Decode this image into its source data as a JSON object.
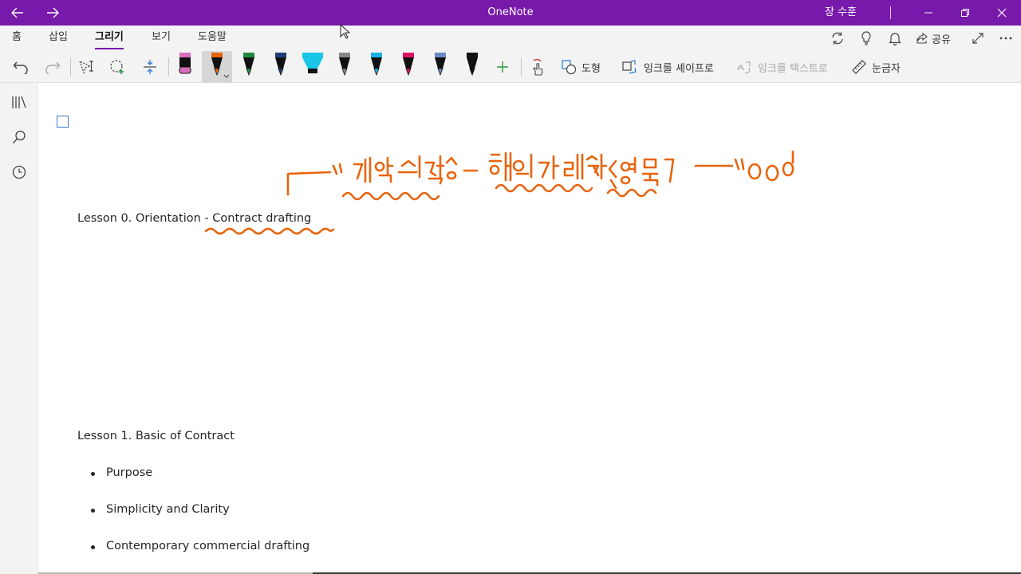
{
  "titlebar": {
    "app_title": "OneNote",
    "user_name": "장 수훈",
    "back_icon": "arrow-left-icon",
    "forward_icon": "arrow-right-icon",
    "color": "#7719aa"
  },
  "menu": {
    "tabs": [
      {
        "label": "홈"
      },
      {
        "label": "삽입"
      },
      {
        "label": "그리기"
      },
      {
        "label": "보기"
      },
      {
        "label": "도움말"
      }
    ],
    "active_tab": "그리기",
    "share_label": "공유"
  },
  "toolbar": {
    "shape_label": "도형",
    "ink_to_shape_label": "잉크를 셰이프로",
    "ink_to_text_label": "잉크를 텍스트로",
    "ruler_label": "눈금자",
    "pen_colors": [
      "#d86ec0",
      "#e8640c",
      "#1f8a3c",
      "#1f3f7a",
      "#19c6e6",
      "#888888",
      "#19b4e6",
      "#e0136b",
      "#6a8ac8",
      "#111111"
    ],
    "selected_pen_color": "#e8640c"
  },
  "page": {
    "lesson0_prefix": "Lesson 0. Orientation ",
    "lesson0_suffix": "- Contract drafting",
    "lesson1_title": "Lesson 1. Basic of Contract",
    "bullets": [
      "Purpose",
      "Simplicity and Clarity",
      "Contemporary commercial drafting"
    ]
  },
  "ink_annotation": {
    "color": "#e8640c",
    "handwritten_text": "계약서 작성 – 해외 거래처 (영문) → 000"
  }
}
